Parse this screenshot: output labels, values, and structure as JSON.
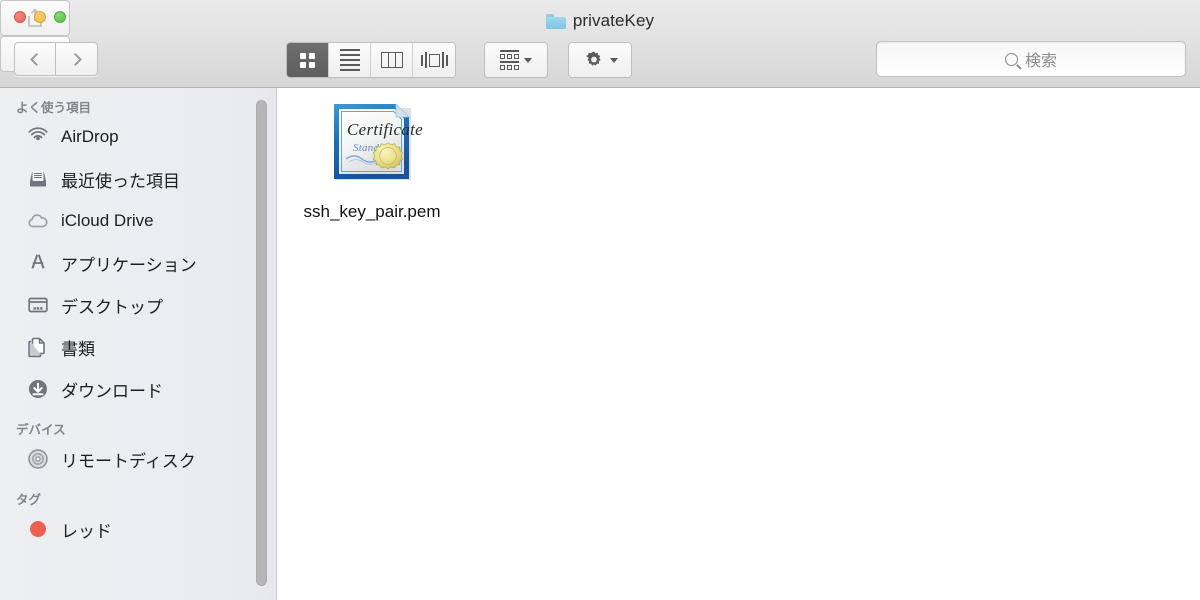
{
  "window": {
    "title": "privateKey",
    "title_icon": "folder-icon",
    "traffic_lights": [
      {
        "name": "close",
        "color": "#E4695C"
      },
      {
        "name": "minimize",
        "color": "#F3BB42"
      },
      {
        "name": "zoom",
        "color": "#5DBF4C"
      }
    ]
  },
  "toolbar": {
    "nav": {
      "back_icon": "chevron-left-icon",
      "forward_icon": "chevron-right-icon"
    },
    "view_modes": [
      {
        "name": "icon-view",
        "icon": "grid-icon",
        "active": true
      },
      {
        "name": "list-view",
        "icon": "list-icon",
        "active": false
      },
      {
        "name": "column-view",
        "icon": "columns-icon",
        "active": false
      },
      {
        "name": "cover-flow",
        "icon": "coverflow-icon",
        "active": false
      }
    ],
    "arrange": {
      "name": "arrange-by",
      "icon": "arrange-icon",
      "caret": "chevron-down-icon"
    },
    "action": {
      "name": "action-menu",
      "icon": "gear-icon",
      "caret": "chevron-down-icon"
    },
    "share": {
      "name": "share-button",
      "icon": "share-icon"
    },
    "tags": {
      "name": "tags-button",
      "icon": "tag-icon"
    }
  },
  "search": {
    "icon": "search-icon",
    "placeholder": "検索",
    "value": ""
  },
  "sidebar": {
    "sections": [
      {
        "header": "よく使う項目",
        "items": [
          {
            "label": "AirDrop",
            "icon": "airdrop-icon"
          },
          {
            "label": "最近使った項目",
            "icon": "recents-icon"
          },
          {
            "label": "iCloud Drive",
            "icon": "icloud-icon"
          },
          {
            "label": "アプリケーション",
            "icon": "applications-icon"
          },
          {
            "label": "デスクトップ",
            "icon": "desktop-icon"
          },
          {
            "label": "書類",
            "icon": "documents-icon"
          },
          {
            "label": "ダウンロード",
            "icon": "downloads-icon"
          }
        ]
      },
      {
        "header": "デバイス",
        "items": [
          {
            "label": "リモートディスク",
            "icon": "remote-disc-icon"
          }
        ]
      },
      {
        "header": "タグ",
        "items": [
          {
            "label": "レッド",
            "icon": "tag-dot-icon",
            "color": "#F0604F"
          }
        ]
      }
    ]
  },
  "content": {
    "files": [
      {
        "name": "ssh_key_pair.pem",
        "icon": "certificate-icon",
        "icon_text_main": "Certificate",
        "icon_text_sub": "Standard"
      }
    ]
  }
}
